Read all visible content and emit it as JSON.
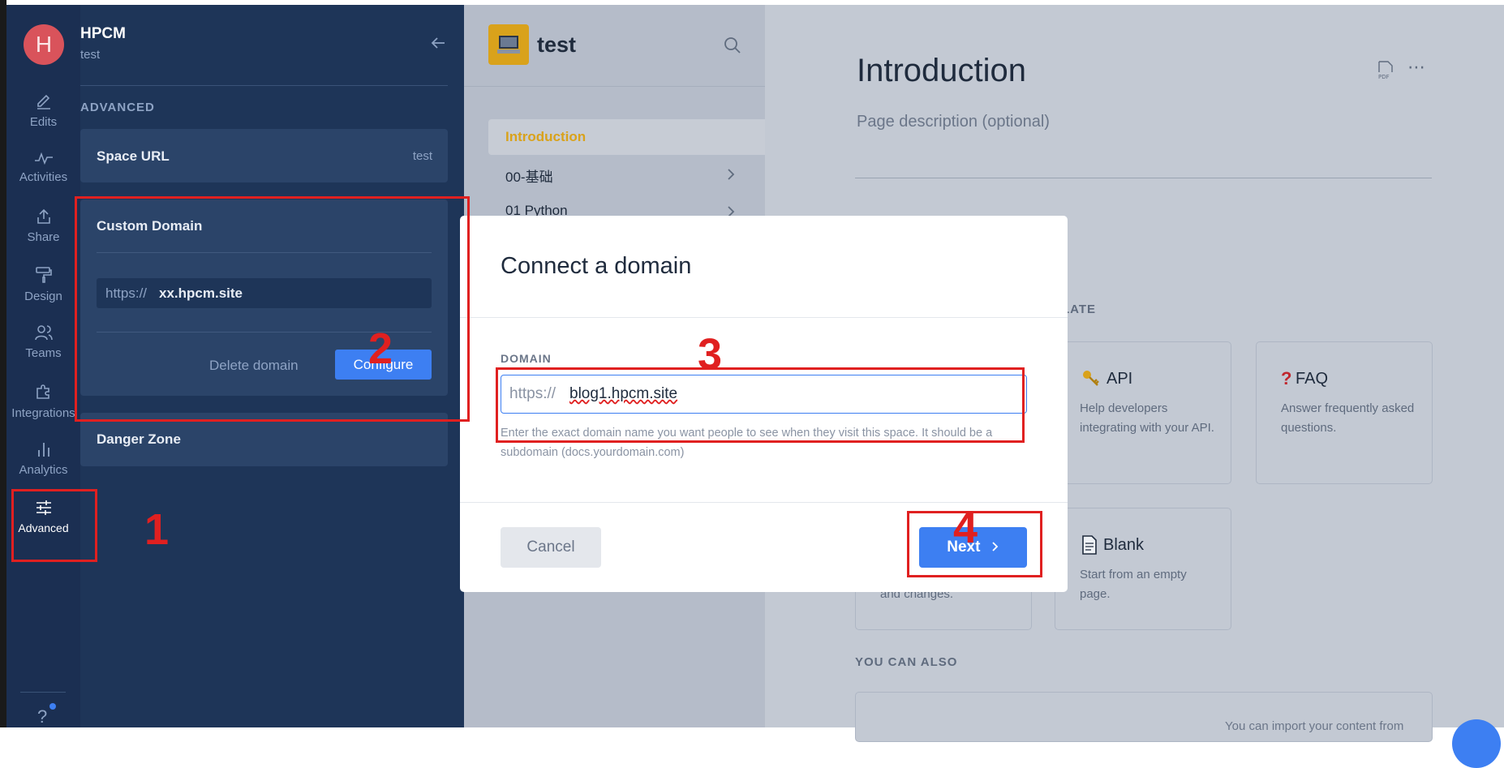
{
  "app": {
    "avatar_letter": "H",
    "space_name": "HPCM",
    "space_sub": "test"
  },
  "rail": {
    "items": [
      {
        "label": "Edits",
        "icon": "edit-icon"
      },
      {
        "label": "Activities",
        "icon": "activity-icon"
      },
      {
        "label": "Share",
        "icon": "share-icon"
      },
      {
        "label": "Design",
        "icon": "paint-roller-icon"
      },
      {
        "label": "Teams",
        "icon": "users-icon"
      },
      {
        "label": "Integrations",
        "icon": "puzzle-icon"
      },
      {
        "label": "Analytics",
        "icon": "bar-chart-icon"
      },
      {
        "label": "Advanced",
        "icon": "sliders-icon"
      }
    ],
    "help": "?"
  },
  "settings": {
    "section_heading": "ADVANCED",
    "space_url_label": "Space URL",
    "space_url_value": "test",
    "custom_domain_label": "Custom Domain",
    "domain_prefix": "https://",
    "domain_value": "xx.hpcm.site",
    "delete_label": "Delete domain",
    "configure_label": "Configure",
    "danger_label": "Danger Zone"
  },
  "middle": {
    "space_title": "test",
    "pages": [
      {
        "label": "Introduction",
        "active": true
      },
      {
        "label": "00-基础",
        "active": false
      },
      {
        "label": "01 Python",
        "active": false
      }
    ]
  },
  "page": {
    "title": "Introduction",
    "description_placeholder": "Page description (optional)",
    "template_heading_partial": "LATE",
    "templates": [
      {
        "title": "API",
        "icon": "key-icon",
        "desc": "Help developers integrating with your API."
      },
      {
        "title": "FAQ",
        "icon": "question-icon",
        "desc": "Answer frequently asked questions."
      },
      {
        "title": "Blank",
        "icon": "page-icon",
        "desc": "Start from an empty page."
      }
    ],
    "partial_card_text": "and changes.",
    "also_heading": "YOU CAN ALSO",
    "import_partial": "You can import your content from"
  },
  "modal": {
    "title": "Connect a domain",
    "field_label": "DOMAIN",
    "prefix": "https://",
    "value": "blog1.hpcm.site",
    "help": "Enter the exact domain name you want people to see when they visit this space. It should be a subdomain (docs.yourdomain.com)",
    "cancel": "Cancel",
    "next": "Next"
  },
  "annotations": [
    "1",
    "2",
    "3",
    "4"
  ],
  "colors": {
    "rail_bg": "#1b2f52",
    "accent_blue": "#3d7ff2",
    "annotation_red": "#e02020",
    "active_page": "#d9a21b"
  }
}
